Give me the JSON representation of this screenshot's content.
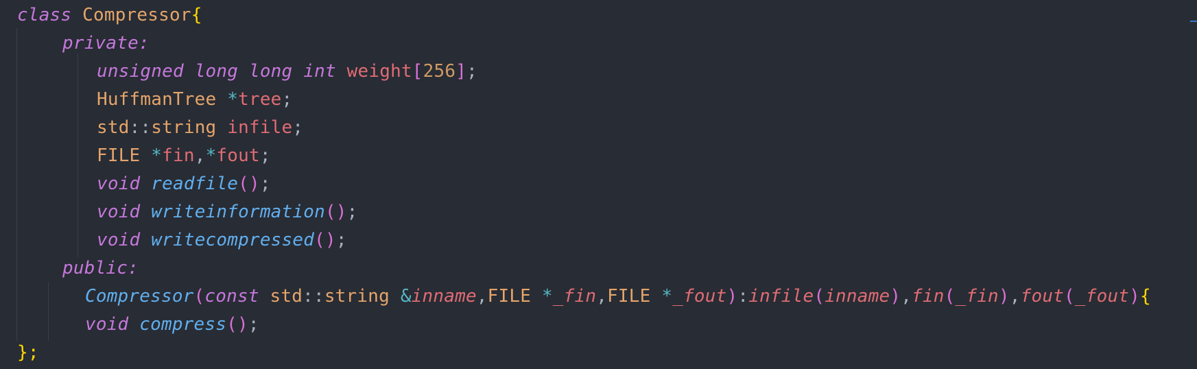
{
  "lines": [
    [
      {
        "t": "class",
        "c": "k"
      },
      {
        "t": " ",
        "c": "p"
      },
      {
        "t": "Compressor",
        "c": "t"
      },
      {
        "t": "{",
        "c": "b"
      }
    ],
    [
      {
        "t": "private:",
        "c": "k"
      }
    ],
    [
      {
        "t": "unsigned",
        "c": "k"
      },
      {
        "t": " ",
        "c": "p"
      },
      {
        "t": "long",
        "c": "k"
      },
      {
        "t": " ",
        "c": "p"
      },
      {
        "t": "long",
        "c": "k"
      },
      {
        "t": " ",
        "c": "p"
      },
      {
        "t": "int",
        "c": "k"
      },
      {
        "t": " ",
        "c": "p"
      },
      {
        "t": "weight",
        "c": "v"
      },
      {
        "t": "[",
        "c": "bp"
      },
      {
        "t": "256",
        "c": "n"
      },
      {
        "t": "]",
        "c": "bp"
      },
      {
        "t": ";",
        "c": "p"
      }
    ],
    [
      {
        "t": "HuffmanTree",
        "c": "t"
      },
      {
        "t": " ",
        "c": "p"
      },
      {
        "t": "*",
        "c": "o"
      },
      {
        "t": "tree",
        "c": "v"
      },
      {
        "t": ";",
        "c": "p"
      }
    ],
    [
      {
        "t": "std",
        "c": "t"
      },
      {
        "t": "::",
        "c": "p"
      },
      {
        "t": "string",
        "c": "t"
      },
      {
        "t": " ",
        "c": "p"
      },
      {
        "t": "infile",
        "c": "v"
      },
      {
        "t": ";",
        "c": "p"
      }
    ],
    [
      {
        "t": "FILE",
        "c": "t"
      },
      {
        "t": " ",
        "c": "p"
      },
      {
        "t": "*",
        "c": "o"
      },
      {
        "t": "fin",
        "c": "v"
      },
      {
        "t": ",",
        "c": "p"
      },
      {
        "t": "*",
        "c": "o"
      },
      {
        "t": "fout",
        "c": "v"
      },
      {
        "t": ";",
        "c": "p"
      }
    ],
    [
      {
        "t": "void",
        "c": "k"
      },
      {
        "t": " ",
        "c": "p"
      },
      {
        "t": "readfile",
        "c": "f"
      },
      {
        "t": "()",
        "c": "bp"
      },
      {
        "t": ";",
        "c": "p"
      }
    ],
    [
      {
        "t": "void",
        "c": "k"
      },
      {
        "t": " ",
        "c": "p"
      },
      {
        "t": "writeinformation",
        "c": "f"
      },
      {
        "t": "()",
        "c": "bp"
      },
      {
        "t": ";",
        "c": "p"
      }
    ],
    [
      {
        "t": "void",
        "c": "k"
      },
      {
        "t": " ",
        "c": "p"
      },
      {
        "t": "writecompressed",
        "c": "f"
      },
      {
        "t": "()",
        "c": "bp"
      },
      {
        "t": ";",
        "c": "p"
      }
    ],
    [
      {
        "t": "public:",
        "c": "k"
      }
    ],
    [
      {
        "t": "Compressor",
        "c": "f"
      },
      {
        "t": "(",
        "c": "bp"
      },
      {
        "t": "const",
        "c": "k"
      },
      {
        "t": " ",
        "c": "p"
      },
      {
        "t": "std",
        "c": "t"
      },
      {
        "t": "::",
        "c": "p"
      },
      {
        "t": "string",
        "c": "t"
      },
      {
        "t": " ",
        "c": "p"
      },
      {
        "t": "&",
        "c": "o"
      },
      {
        "t": "inname",
        "c": "vi"
      },
      {
        "t": ",",
        "c": "p"
      },
      {
        "t": "FILE",
        "c": "t"
      },
      {
        "t": " ",
        "c": "p"
      },
      {
        "t": "*",
        "c": "o"
      },
      {
        "t": "_fin",
        "c": "vi"
      },
      {
        "t": ",",
        "c": "p"
      },
      {
        "t": "FILE",
        "c": "t"
      },
      {
        "t": " ",
        "c": "p"
      },
      {
        "t": "*",
        "c": "o"
      },
      {
        "t": "_fout",
        "c": "vi"
      },
      {
        "t": ")",
        "c": "bp"
      },
      {
        "t": ":",
        "c": "p"
      },
      {
        "t": "infile",
        "c": "vi"
      },
      {
        "t": "(",
        "c": "bp"
      },
      {
        "t": "inname",
        "c": "vi"
      },
      {
        "t": ")",
        "c": "bp"
      },
      {
        "t": ",",
        "c": "p"
      },
      {
        "t": "fin",
        "c": "vi"
      },
      {
        "t": "(",
        "c": "bp"
      },
      {
        "t": "_fin",
        "c": "vi"
      },
      {
        "t": ")",
        "c": "bp"
      },
      {
        "t": ",",
        "c": "p"
      },
      {
        "t": "fout",
        "c": "vi"
      },
      {
        "t": "(",
        "c": "bp"
      },
      {
        "t": "_fout",
        "c": "vi"
      },
      {
        "t": ")",
        "c": "bp"
      },
      {
        "t": "{",
        "c": "b"
      }
    ],
    [
      {
        "t": "void",
        "c": "k"
      },
      {
        "t": " ",
        "c": "p"
      },
      {
        "t": "compress",
        "c": "f"
      },
      {
        "t": "()",
        "c": "bp"
      },
      {
        "t": ";",
        "c": "p"
      }
    ],
    [
      {
        "t": "};",
        "c": "b"
      }
    ]
  ]
}
